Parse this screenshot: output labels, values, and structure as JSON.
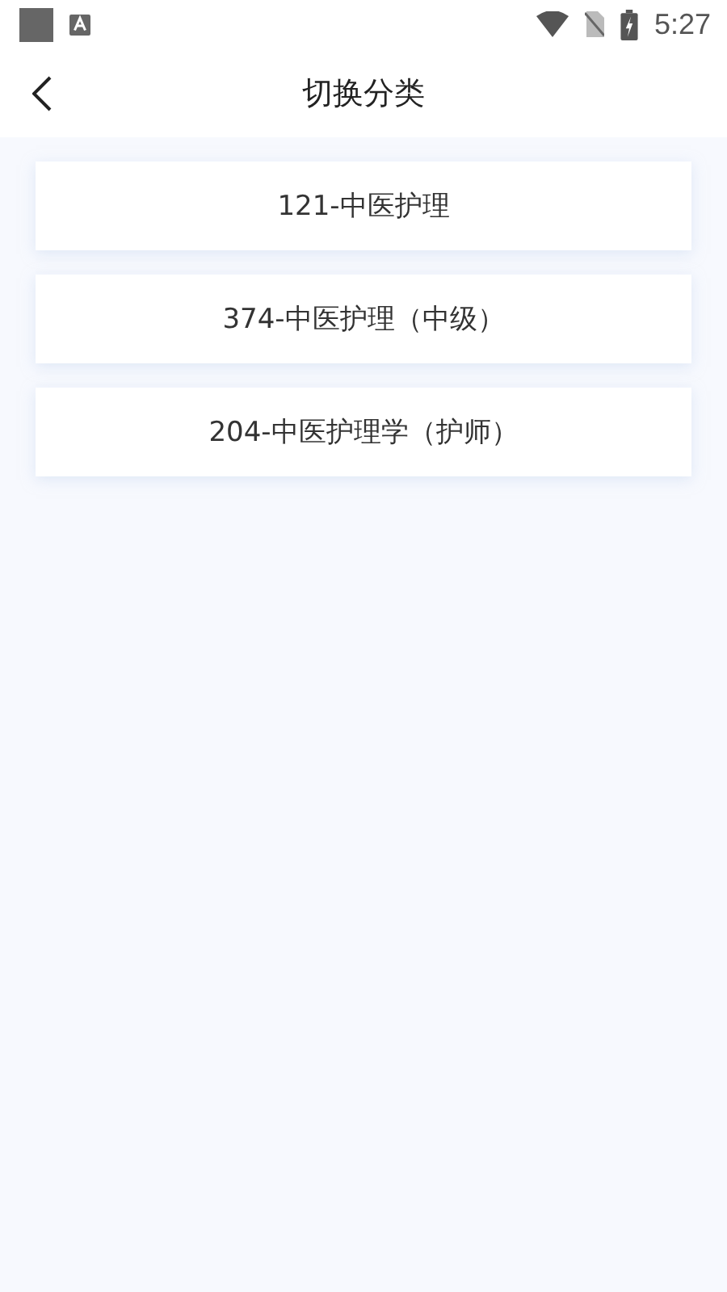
{
  "status_bar": {
    "time": "5:27"
  },
  "header": {
    "title": "切换分类"
  },
  "categories": [
    {
      "label": "121-中医护理"
    },
    {
      "label": "374-中医护理（中级）"
    },
    {
      "label": "204-中医护理学（护师）"
    }
  ]
}
